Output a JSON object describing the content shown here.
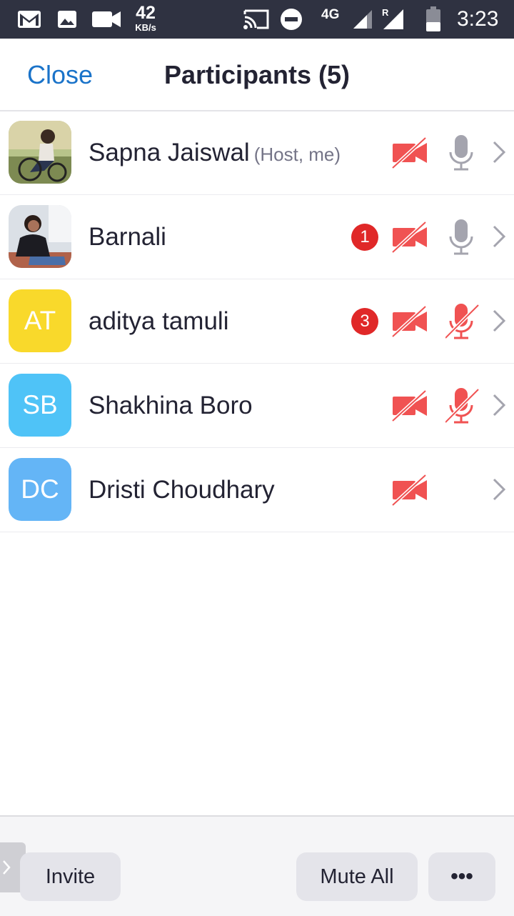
{
  "status_bar": {
    "net_speed_value": "42",
    "net_speed_unit": "KB/s",
    "network_type": "4G",
    "roaming_indicator": "R",
    "time": "3:23",
    "icons": [
      "gmail-icon",
      "image-icon",
      "video-icon",
      "cast-icon",
      "dnd-icon",
      "signal-icon",
      "signal-roaming-icon",
      "battery-icon"
    ]
  },
  "header": {
    "close_label": "Close",
    "title": "Participants (5)"
  },
  "participants": [
    {
      "name": "Sapna Jaiswal",
      "role": "(Host, me)",
      "avatar_type": "photo",
      "badge": "",
      "video": "off",
      "audio": "on"
    },
    {
      "name": "Barnali",
      "role": "",
      "avatar_type": "photo",
      "badge": "1",
      "video": "off",
      "audio": "on"
    },
    {
      "name": "aditya tamuli",
      "role": "",
      "avatar_type": "initials",
      "initials": "AT",
      "avatar_color": "#f9d92b",
      "badge": "3",
      "video": "off",
      "audio": "muted"
    },
    {
      "name": "Shakhina Boro",
      "role": "",
      "avatar_type": "initials",
      "initials": "SB",
      "avatar_color": "#4fc3f7",
      "badge": "",
      "video": "off",
      "audio": "muted"
    },
    {
      "name": "Dristi Choudhary",
      "role": "",
      "avatar_type": "initials",
      "initials": "DC",
      "avatar_color": "#64b5f6",
      "badge": "",
      "video": "off",
      "audio": "none"
    }
  ],
  "footer": {
    "invite_label": "Invite",
    "mute_all_label": "Mute All",
    "more_label": "•••"
  },
  "colors": {
    "accent": "#1a73c9",
    "muted_red": "#f05252",
    "badge_red": "#e02828",
    "status_bar_bg": "#2f3241"
  }
}
